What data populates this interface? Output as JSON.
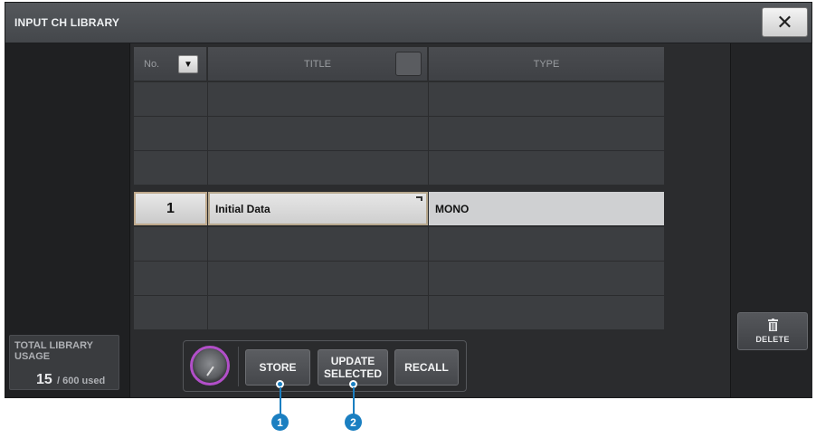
{
  "window": {
    "title": "INPUT CH LIBRARY"
  },
  "table": {
    "headers": {
      "no": "No.",
      "title": "TITLE",
      "type": "TYPE"
    },
    "rows": [
      {
        "no": "",
        "title": "",
        "type": ""
      },
      {
        "no": "",
        "title": "",
        "type": ""
      },
      {
        "no": "",
        "title": "",
        "type": ""
      },
      {
        "no": "1",
        "title": "Initial Data",
        "type": "MONO",
        "selected": true
      },
      {
        "no": "",
        "title": "",
        "type": ""
      },
      {
        "no": "",
        "title": "",
        "type": ""
      },
      {
        "no": "",
        "title": "",
        "type": ""
      }
    ]
  },
  "usage": {
    "label": "TOTAL LIBRARY USAGE",
    "used": "15",
    "total": "/ 600 used"
  },
  "buttons": {
    "store": "STORE",
    "update_line1": "UPDATE",
    "update_line2": "SELECTED",
    "recall": "RECALL",
    "delete": "DELETE"
  },
  "callouts": [
    "1",
    "2"
  ],
  "colors": {
    "knob_ring": "#b24fc9",
    "callout": "#1b7fc1"
  },
  "icons": {
    "close": "close-icon",
    "sort": "chevron-down-icon",
    "delete": "trash-icon",
    "edit": "edit-icon"
  }
}
